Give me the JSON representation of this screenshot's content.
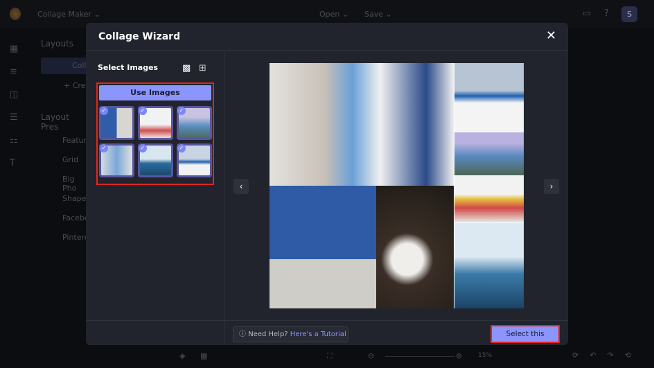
{
  "app": {
    "name": "Collage Maker",
    "open": "Open",
    "save": "Save",
    "avatar": "S",
    "zoom": "15%"
  },
  "sidebar": {
    "heading": "Layouts",
    "collage_btn": "Colla",
    "create_btn": "+ Cre",
    "presets_heading": "Layout Pres",
    "items": [
      "Featur",
      "Grid",
      "Big Pho",
      "Shape",
      "Facebo",
      "Pintere"
    ]
  },
  "modal": {
    "title": "Collage Wizard",
    "close": "✕",
    "select_images": "Select Images",
    "use_images": "Use Images",
    "help": "Need Help?",
    "tutorial": "Here's a Tutorial",
    "select_collage": "Select this Collage",
    "prev": "‹",
    "next": "›"
  },
  "colors": {
    "accent": "#8b95fb",
    "highlight": "#e0261f"
  }
}
